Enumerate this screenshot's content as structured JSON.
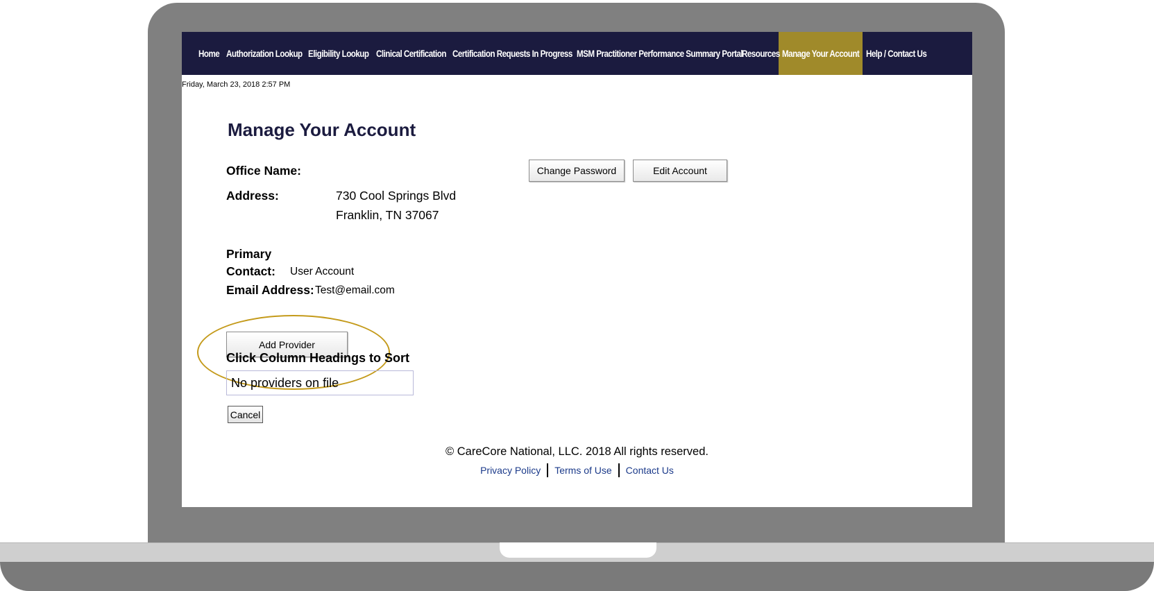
{
  "nav": {
    "items": [
      {
        "label": "Home",
        "active": false
      },
      {
        "label": "Authorization Lookup",
        "active": false
      },
      {
        "label": "Eligibility Lookup",
        "active": false
      },
      {
        "label": "Clinical Certification",
        "active": false
      },
      {
        "label": "Certification Requests In Progress",
        "active": false
      },
      {
        "label": "MSM Practitioner Performance Summary Portal",
        "active": false
      },
      {
        "label": "Resources",
        "active": false
      },
      {
        "label": "Manage Your Account",
        "active": true
      },
      {
        "label": "Help / Contact Us",
        "active": false
      }
    ]
  },
  "datetime": "Friday, March 23, 2018 2:57 PM",
  "page": {
    "title": "Manage Your Account",
    "office_name_label": "Office Name:",
    "address_label": "Address:",
    "address_line1": "730 Cool Springs Blvd",
    "address_line2": "Franklin, TN 37067",
    "primary_label": "Primary",
    "contact_label": "Contact:",
    "contact_value": "User Account",
    "email_label": "Email Address:",
    "email_value": "Test@email.com",
    "change_password_label": "Change Password",
    "edit_account_label": "Edit Account",
    "add_provider_label": "Add Provider",
    "sort_hint": "Click Column Headings to Sort",
    "empty_grid_text": "No providers on file",
    "cancel_label": "Cancel"
  },
  "footer": {
    "copyright": "© CareCore National, LLC. 2018 All rights reserved.",
    "links": [
      "Privacy Policy",
      "Terms of Use",
      "Contact Us"
    ]
  },
  "colors": {
    "nav_bg": "#1b1b3f",
    "nav_active": "#a08a2a",
    "highlight_ring": "#c49a1a"
  }
}
